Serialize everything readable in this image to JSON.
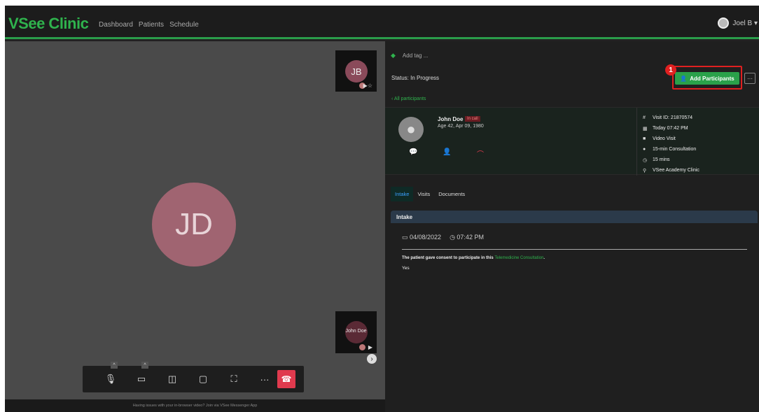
{
  "nav": {
    "brand": "VSee Clinic",
    "links": [
      "Dashboard",
      "Patients",
      "Schedule"
    ],
    "user": "Joel B ▾"
  },
  "video": {
    "main_initials": "JD",
    "self_thumb_initials": "JB",
    "patient_thumb_name": "John Doe",
    "footer_note": "Having issues with your in-browser video? Join via VSee Messenger App"
  },
  "panel": {
    "add_tag": "Add tag ...",
    "status": "Status: In Progress",
    "step_badge": "1",
    "add_participants": "Add Participants",
    "more": "···",
    "all_participants": "‹ All participants",
    "patient": {
      "name": "John Doe",
      "badge": "In call",
      "age_dob": "Age 42, Apr 09, 1980"
    },
    "visit_info": [
      {
        "icon": "hash-icon",
        "text": "Visit ID: 21870574"
      },
      {
        "icon": "calendar-icon",
        "text": "Today 07:42 PM"
      },
      {
        "icon": "video-icon",
        "text": "Video Visit"
      },
      {
        "icon": "info-icon",
        "text": "15-min Consultation"
      },
      {
        "icon": "clock-icon",
        "text": "15 mins"
      },
      {
        "icon": "location-icon",
        "text": "VSee Academy Clinic"
      }
    ],
    "tabs": [
      "Intake",
      "Visits",
      "Documents"
    ],
    "intake_title": "Intake",
    "date": "04/08/2022",
    "time": "07:42 PM",
    "consent_text": "The patient gave consent to participate in this",
    "consent_link": "Telemedicine Consultation",
    "consent_end": ".",
    "answer": "Yes"
  },
  "colors": {
    "brand_green": "#2fb34d",
    "end_call_red": "#e03a4e",
    "highlight_red": "#e02020"
  }
}
